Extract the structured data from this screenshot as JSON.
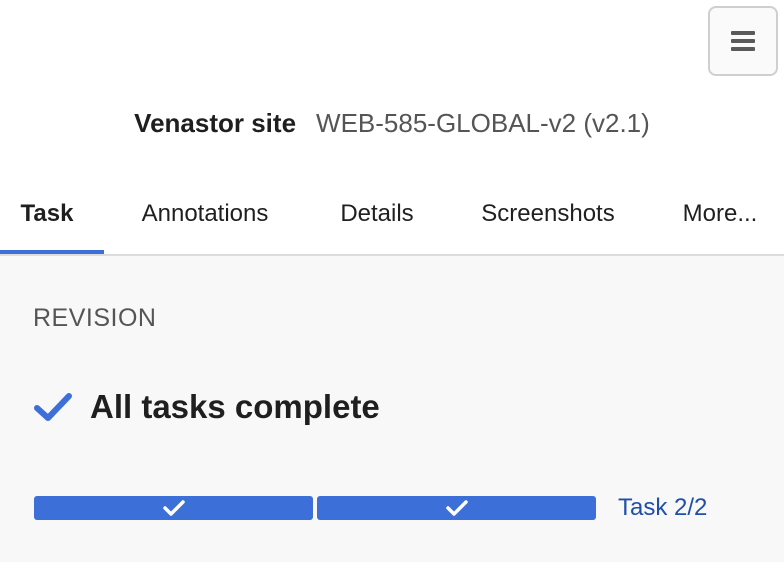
{
  "header": {
    "site_name": "Venastor site",
    "site_version": "WEB-585-GLOBAL-v2 (v2.1)",
    "menu_icon": "hamburger-menu-icon"
  },
  "tabs": [
    {
      "label": "Task",
      "active": true
    },
    {
      "label": "Annotations",
      "active": false
    },
    {
      "label": "Details",
      "active": false
    },
    {
      "label": "Screenshots",
      "active": false
    },
    {
      "label": "More...",
      "active": false
    }
  ],
  "revision": {
    "section_label": "REVISION",
    "status_icon": "checkmark-icon",
    "status_text": "All tasks complete",
    "progress": {
      "segments": [
        {
          "complete": true
        },
        {
          "complete": true
        }
      ],
      "task_count": "Task 2/2"
    }
  },
  "colors": {
    "accent": "#3d6fd8",
    "link": "#1f4fa8",
    "content_bg": "#f8f8f8"
  }
}
